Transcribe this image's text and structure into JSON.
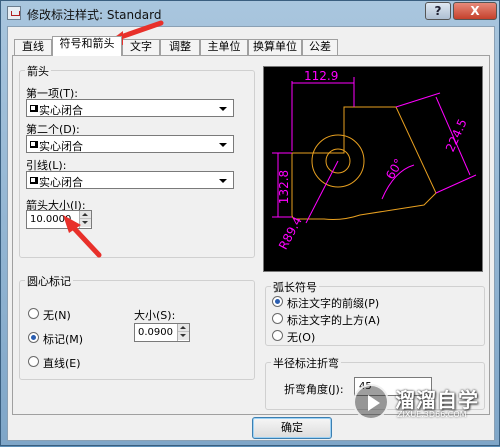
{
  "window": {
    "title": "修改标注样式: Standard",
    "help_label": "?",
    "close_label": "X"
  },
  "tabs": [
    {
      "label": "直线"
    },
    {
      "label": "符号和箭头",
      "active": true
    },
    {
      "label": "文字"
    },
    {
      "label": "调整"
    },
    {
      "label": "主单位"
    },
    {
      "label": "换算单位"
    },
    {
      "label": "公差"
    }
  ],
  "arrowheads": {
    "group_label": "箭头",
    "first_label": "第一项(T):",
    "first_value": "实心闭合",
    "second_label": "第二个(D):",
    "second_value": "实心闭合",
    "leader_label": "引线(L):",
    "leader_value": "实心闭合",
    "size_label": "箭头大小(I):",
    "size_value": "10.0000"
  },
  "preview": {
    "dim_top": "112.9",
    "dim_left": "132.8",
    "dim_right": "224.5",
    "dim_angle": "60°",
    "dim_radius": "R89.4"
  },
  "center_marks": {
    "group_label": "圆心标记",
    "none_label": "无(N)",
    "mark_label": "标记(M)",
    "line_label": "直线(E)",
    "selected": "标记(M)",
    "size_label": "大小(S):",
    "size_value": "0.0900"
  },
  "arc_length": {
    "group_label": "弧长符号",
    "preceding_label": "标注文字的前缀(P)",
    "above_label": "标注文字的上方(A)",
    "none_label": "无(O)",
    "selected": "标注文字的前缀(P)"
  },
  "radius_jog": {
    "group_label": "半径标注折弯",
    "angle_label": "折弯角度(J):",
    "angle_value": "45"
  },
  "buttons": {
    "ok_label": "确定"
  },
  "colors": {
    "dimension": "#ff00ff",
    "object": "#e8a020",
    "annotation_arrow": "#e8302a"
  },
  "watermark": {
    "title": "溜溜自学",
    "url": "ZIXUE.3D66.COM"
  }
}
